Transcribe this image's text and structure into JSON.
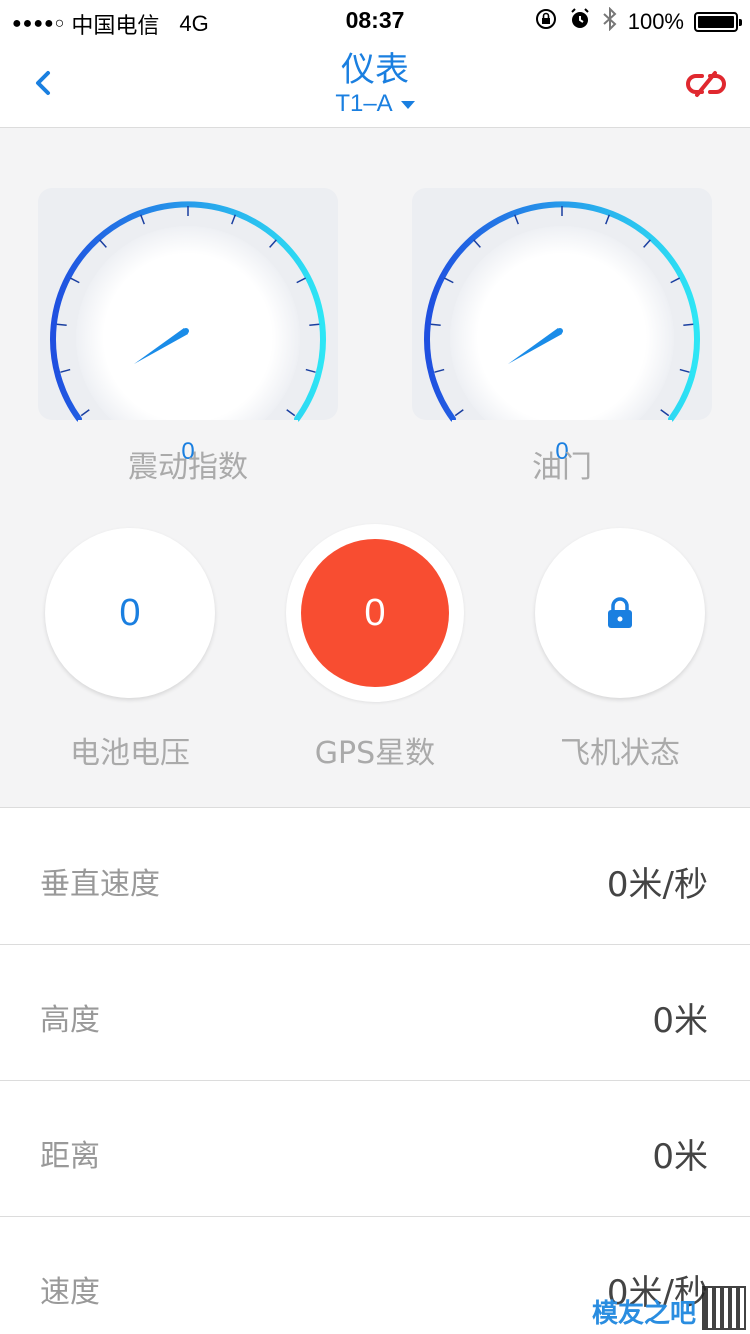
{
  "status_bar": {
    "carrier": "中国电信",
    "network": "4G",
    "time": "08:37",
    "battery": "100%"
  },
  "nav": {
    "title": "仪表",
    "subtitle": "T1–A"
  },
  "gauges": [
    {
      "label": "震动指数",
      "value": "0"
    },
    {
      "label": "油门",
      "value": "0"
    }
  ],
  "indicators": [
    {
      "label": "电池电压",
      "value": "0"
    },
    {
      "label": "GPS星数",
      "value": "0"
    },
    {
      "label": "飞机状态",
      "icon": "lock-icon"
    }
  ],
  "stats": [
    {
      "label": "垂直速度",
      "value": "0米/秒"
    },
    {
      "label": "高度",
      "value": "0米"
    },
    {
      "label": "距离",
      "value": "0米"
    },
    {
      "label": "速度",
      "value": "0米/秒"
    }
  ],
  "watermark": {
    "text": "模友之吧"
  },
  "colors": {
    "accent": "#1a7fe0",
    "gps_alert": "#f84d31",
    "unlink": "#e0282f",
    "gauge_gradient_start": "#1f4fe0",
    "gauge_gradient_end": "#2ee6f5"
  }
}
